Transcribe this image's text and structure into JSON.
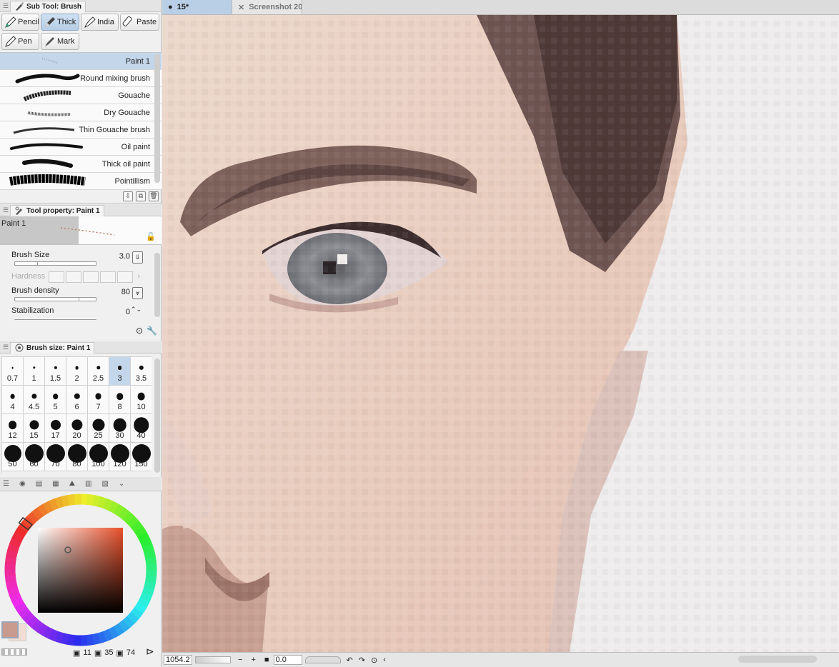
{
  "subtool_panel": {
    "title": "Sub Tool: Brush",
    "tools": [
      {
        "label": "Pencil",
        "selected": false
      },
      {
        "label": "Thick",
        "selected": true
      },
      {
        "label": "India",
        "selected": false
      },
      {
        "label": "Paste",
        "selected": false
      },
      {
        "label": "Pen",
        "selected": false
      },
      {
        "label": "Mark",
        "selected": false
      }
    ]
  },
  "brush_list": [
    {
      "name": "Paint 1",
      "selected": true
    },
    {
      "name": "Round mixing brush",
      "selected": false
    },
    {
      "name": "Gouache",
      "selected": false
    },
    {
      "name": "Dry Gouache",
      "selected": false
    },
    {
      "name": "Thin Gouache brush",
      "selected": false
    },
    {
      "name": "Oil paint",
      "selected": false
    },
    {
      "name": "Thick oil paint",
      "selected": false
    },
    {
      "name": "Pointillism",
      "selected": false
    }
  ],
  "tool_property": {
    "title": "Tool property: Paint 1",
    "preview_name": "Paint 1",
    "brush_size_label": "Brush Size",
    "brush_size_value": "3.0",
    "hardness_label": "Hardness",
    "density_label": "Brush density",
    "density_value": "80",
    "stabilization_label": "Stabilization",
    "stabilization_value": "0"
  },
  "brush_size_panel": {
    "title": "Brush size: Paint 1",
    "sizes": [
      "0.7",
      "1",
      "1.5",
      "2",
      "2.5",
      "3",
      "3.5",
      "4",
      "4.5",
      "5",
      "6",
      "7",
      "8",
      "10",
      "12",
      "15",
      "17",
      "20",
      "25",
      "30",
      "40",
      "50",
      "60",
      "70",
      "80",
      "100",
      "120",
      "150"
    ],
    "selected": "3"
  },
  "color": {
    "main": "#c89b8e",
    "sub": "#f1ddd4",
    "values": [
      "11",
      "35",
      "74"
    ]
  },
  "document_tabs": [
    {
      "label": "15*",
      "active": true
    },
    {
      "label": "Screenshot 20",
      "active": false
    }
  ],
  "status_bar": {
    "zoom": "1054.2",
    "angle": "0.0"
  }
}
